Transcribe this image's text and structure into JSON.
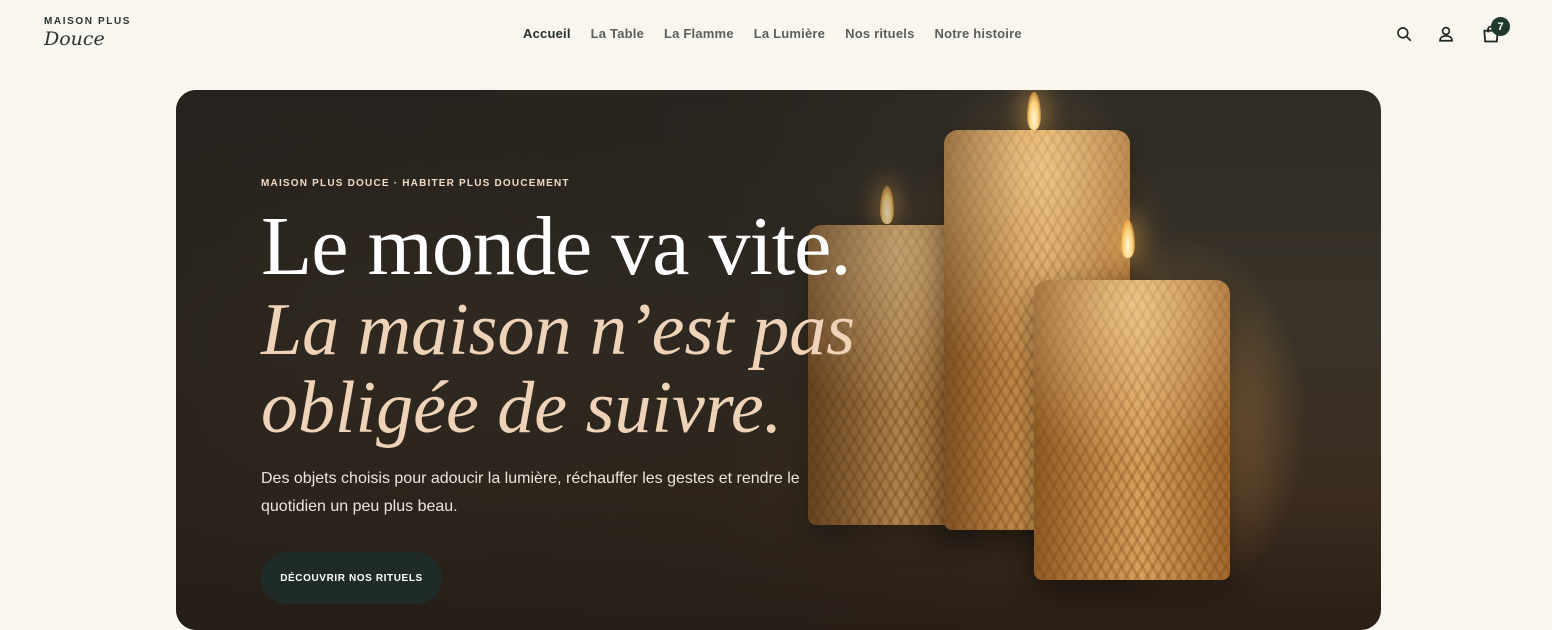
{
  "brand": {
    "top": "MAISON PLUS",
    "bottom": "Douce"
  },
  "nav": {
    "items": [
      {
        "label": "Accueil",
        "active": true
      },
      {
        "label": "La Table"
      },
      {
        "label": "La Flamme"
      },
      {
        "label": "La Lumière"
      },
      {
        "label": "Nos rituels"
      },
      {
        "label": "Notre histoire"
      }
    ]
  },
  "header_icons": {
    "search": "search-icon",
    "account": "user-icon",
    "cart": "shopping-bag-icon"
  },
  "cart": {
    "count": "7"
  },
  "hero": {
    "eyebrow": "MAISON PLUS DOUCE · HABITER PLUS DOUCEMENT",
    "headline": "Le monde va vite.",
    "headline_italic_1": "La maison n’est pas",
    "headline_italic_2": "obligée de suivre.",
    "body": "Des objets choisis pour adoucir la lumière, réchauffer les gestes et rendre le quotidien un peu plus beau.",
    "cta": "DÉCOUVRIR NOS RITUELS"
  },
  "colors": {
    "background": "#f8f6ef",
    "accent_dark_green": "#1f3a2d",
    "headline_italic": "#efd3b8",
    "cta_bg": "#1f2b26"
  }
}
